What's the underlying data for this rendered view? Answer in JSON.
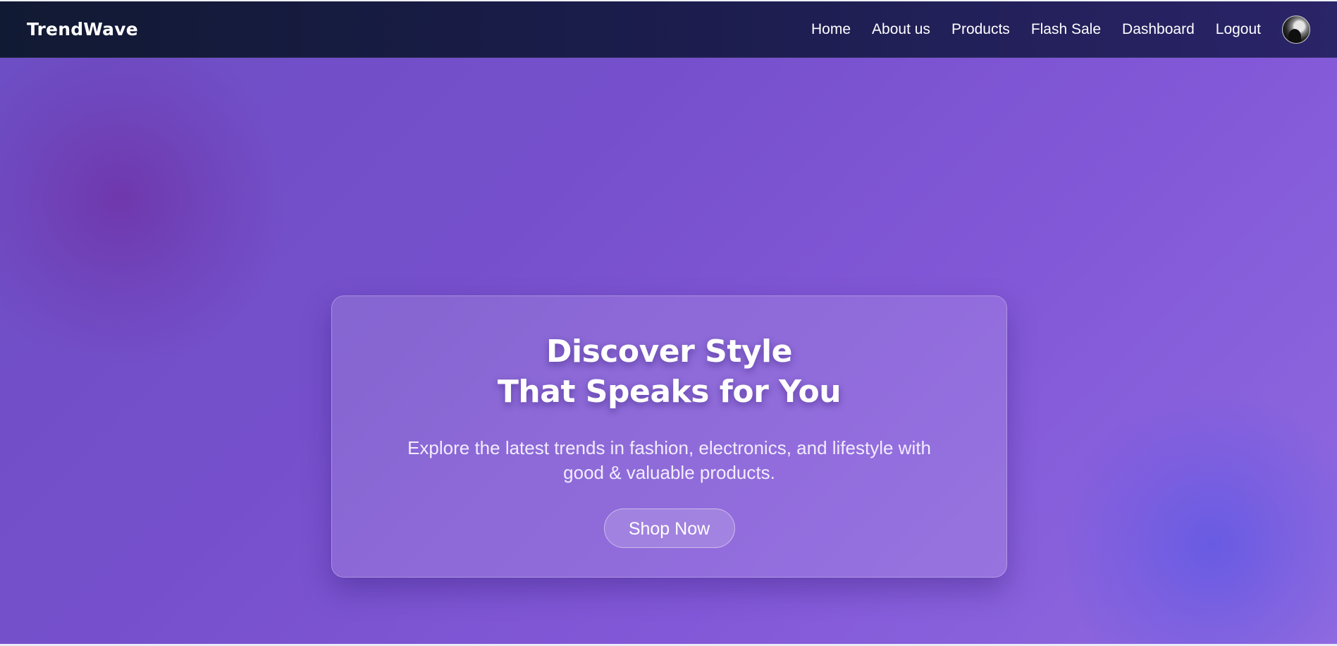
{
  "brand": {
    "name": "TrendWave"
  },
  "nav": {
    "items": [
      {
        "label": "Home"
      },
      {
        "label": "About us"
      },
      {
        "label": "Products"
      },
      {
        "label": "Flash Sale"
      },
      {
        "label": "Dashboard"
      },
      {
        "label": "Logout"
      }
    ],
    "avatar_icon": "user-avatar"
  },
  "hero": {
    "title_line1": "Discover Style",
    "title_line2": "That Speaks for You",
    "subtitle_line1": "Explore the latest trends in fashion, electronics, and lifestyle with",
    "subtitle_line2": "good & valuable products.",
    "cta_label": "Shop Now"
  },
  "colors": {
    "navbar_start": "#111a33",
    "navbar_end": "#2a2468",
    "hero_start": "#6d4ec4",
    "hero_end": "#8f6ae0",
    "text_primary": "#ffffff"
  }
}
